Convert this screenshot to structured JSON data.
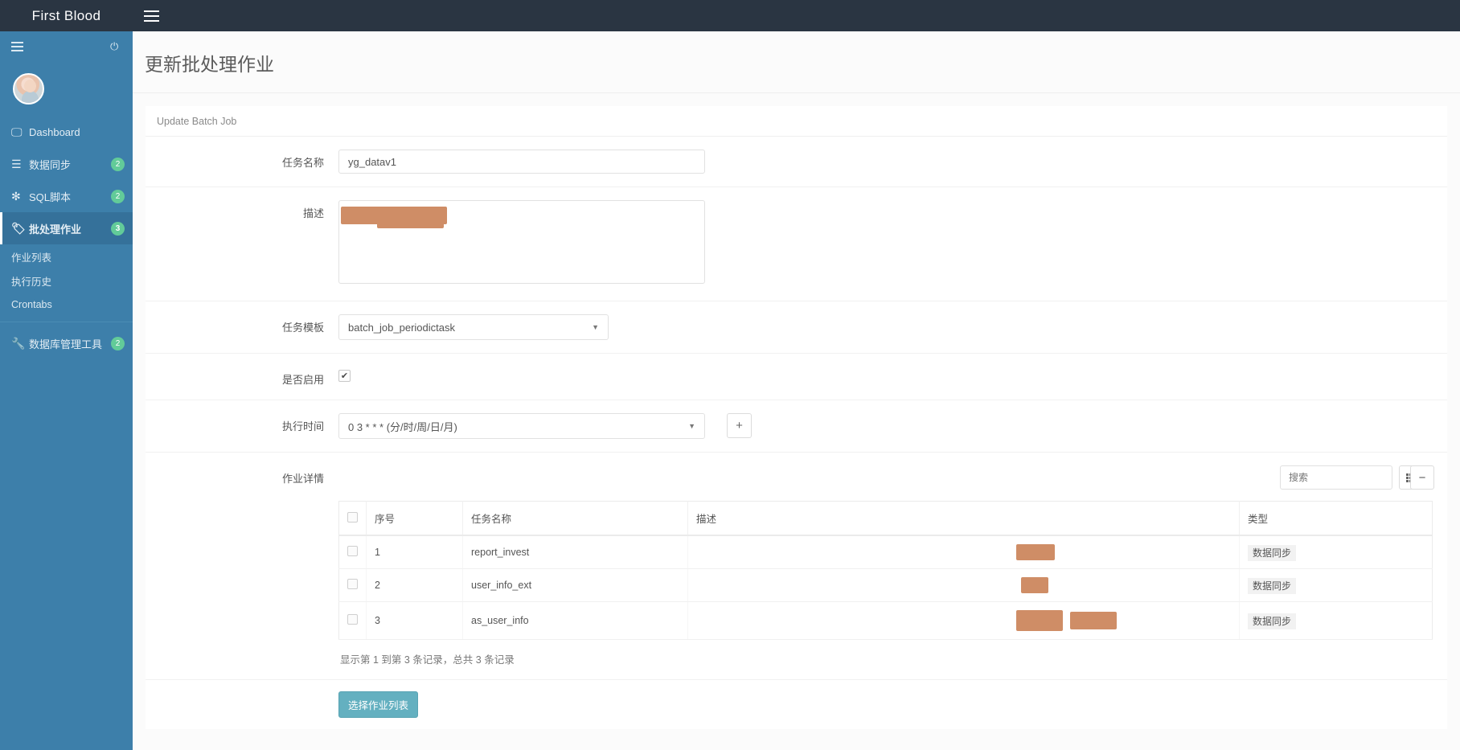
{
  "topbar": {
    "brand": "First Blood",
    "menu_toggle_icon": "hamburger-icon"
  },
  "sidebar": {
    "toggle_icon": "hamburger-icon",
    "power_icon": "power-icon",
    "items": [
      {
        "label": "Dashboard",
        "icon": "monitor-icon",
        "badge": "",
        "active": false
      },
      {
        "label": "数据同步",
        "icon": "list-icon",
        "badge": "2",
        "active": false
      },
      {
        "label": "SQL脚本",
        "icon": "asterisk-icon",
        "badge": "2",
        "active": false
      },
      {
        "label": "批处理作业",
        "icon": "tag-icon",
        "badge": "3",
        "active": true
      },
      {
        "label": "数据库管理工具",
        "icon": "wrench-icon",
        "badge": "2",
        "active": false
      }
    ],
    "sub_items": [
      {
        "label": "作业列表"
      },
      {
        "label": "执行历史"
      },
      {
        "label": "Crontabs"
      }
    ]
  },
  "page": {
    "title": "更新批处理作业",
    "panel_header": "Update Batch Job"
  },
  "form": {
    "task_name_label": "任务名称",
    "task_name_value": "yg_datav1",
    "description_label": "描述",
    "description_value": "",
    "template_label": "任务模板",
    "template_value": "batch_job_periodictask",
    "enabled_label": "是否启用",
    "enabled_checked": true,
    "check_glyph": "✔",
    "schedule_label": "执行时间",
    "schedule_value": "0 3 * * * (分/时/周/日/月)",
    "add_button_label": "+",
    "details_label": "作业详情",
    "select_job_list_button": "选择作业列表"
  },
  "table": {
    "search_placeholder": "搜索",
    "columns_button_icon": "grid-icon",
    "collapse_button_icon": "minus-icon",
    "headers": [
      "序号",
      "任务名称",
      "描述",
      "类型"
    ],
    "rows": [
      {
        "seq": "1",
        "name": "report_invest",
        "desc": "",
        "type": "数据同步"
      },
      {
        "seq": "2",
        "name": "user_info_ext",
        "desc": "",
        "type": "数据同步"
      },
      {
        "seq": "3",
        "name": "as_user_info",
        "desc": "",
        "type": "数据同步"
      }
    ],
    "footer": "显示第 1 到第 3 条记录，总共 3 条记录"
  },
  "colors": {
    "sidebar": "#3d7faa",
    "topbar": "#2a3542",
    "badge": "#62cb99",
    "accent_button": "#64b0c0"
  }
}
